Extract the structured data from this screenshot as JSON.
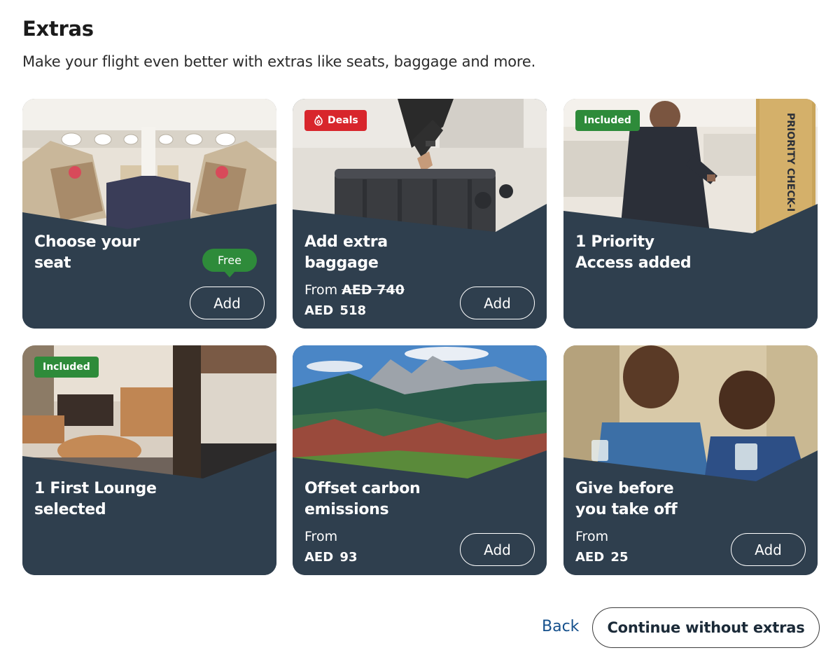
{
  "header": {
    "title": "Extras",
    "subtitle": "Make your flight even better with extras like seats, baggage and more."
  },
  "cards": [
    {
      "title_line1": "Choose your",
      "title_line2": "seat",
      "tag": "Free",
      "button_label": "Add"
    },
    {
      "badge": "Deals",
      "badge_icon": "deal-icon",
      "title_line1": "Add extra",
      "title_line2": "baggage",
      "from_label": "From",
      "old_price": "AED 740",
      "price": "AED 518",
      "button_label": "Add"
    },
    {
      "badge": "Included",
      "title_line1": "1 Priority",
      "title_line2": "Access added",
      "sign_text": "PRIORITY CHECK-I"
    },
    {
      "badge": "Included",
      "title_line1": "1 First Lounge",
      "title_line2": "selected"
    },
    {
      "title_line1": "Offset carbon",
      "title_line2": "emissions",
      "from_label": "From",
      "price": "AED 93",
      "button_label": "Add"
    },
    {
      "title_line1": "Give before",
      "title_line2": "you take off",
      "from_label": "From",
      "price": "AED 25",
      "button_label": "Add"
    }
  ],
  "footer": {
    "back_label": "Back",
    "continue_label": "Continue without extras"
  },
  "colors": {
    "card_panel": "#2f3f4e",
    "deals_badge": "#d8262c",
    "included_badge": "#2e8b3a",
    "link": "#15508c"
  }
}
